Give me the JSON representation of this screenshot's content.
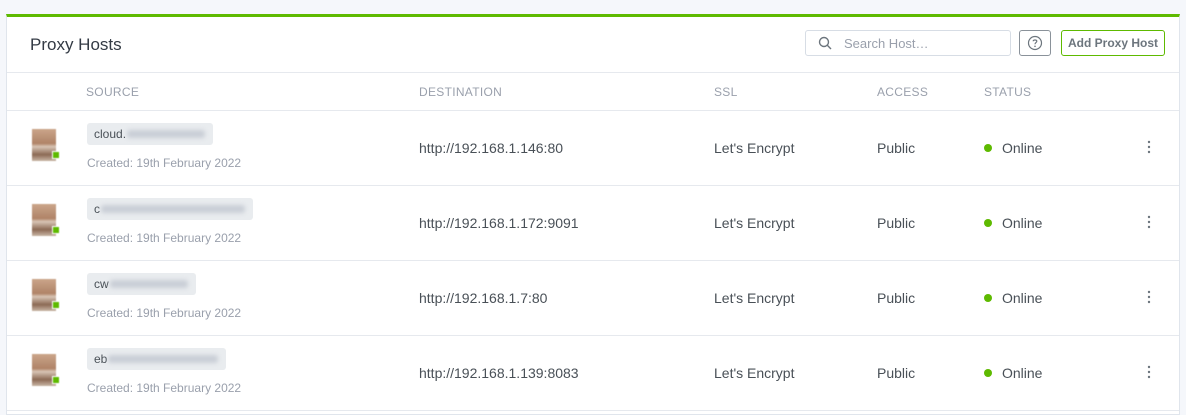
{
  "header": {
    "title": "Proxy Hosts",
    "search_placeholder": "Search Host…",
    "add_button_label": "Add Proxy Host"
  },
  "columns": {
    "source": "SOURCE",
    "destination": "DESTINATION",
    "ssl": "SSL",
    "access": "ACCESS",
    "status": "STATUS"
  },
  "rows": [
    {
      "source_prefix": "cloud.",
      "created": "Created: 19th February 2022",
      "destination": "http://192.168.1.146:80",
      "ssl": "Let's Encrypt",
      "access": "Public",
      "status": "Online"
    },
    {
      "source_prefix": "c",
      "created": "Created: 19th February 2022",
      "destination": "http://192.168.1.172:9091",
      "ssl": "Let's Encrypt",
      "access": "Public",
      "status": "Online"
    },
    {
      "source_prefix": "cw",
      "created": "Created: 19th February 2022",
      "destination": "http://192.168.1.7:80",
      "ssl": "Let's Encrypt",
      "access": "Public",
      "status": "Online"
    },
    {
      "source_prefix": "eb",
      "created": "Created: 19th February 2022",
      "destination": "http://192.168.1.139:8083",
      "ssl": "Let's Encrypt",
      "access": "Public",
      "status": "Online"
    }
  ],
  "colors": {
    "accent": "#5eba00",
    "online": "#5eba00"
  }
}
